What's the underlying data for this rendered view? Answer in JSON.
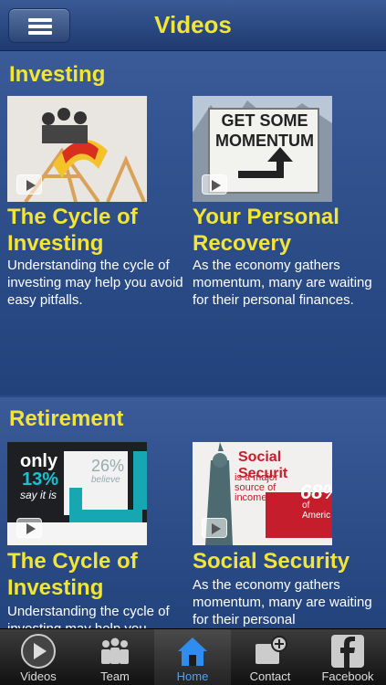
{
  "header": {
    "title": "Videos"
  },
  "sections": [
    {
      "title": "Investing",
      "videos": [
        {
          "title": "The Cycle of Investing",
          "description": "Understanding the cycle of investing may help you avoid easy pitfalls."
        },
        {
          "title": "Your Personal Recovery",
          "description": "As the economy gathers momentum, many are waiting for their personal finances.",
          "thumb_text": "GET SOME MOMENTUM"
        }
      ]
    },
    {
      "title": "Retirement",
      "videos": [
        {
          "title": "The Cycle of Investing",
          "description": "Understanding the cycle of investing may help you...",
          "thumb_text": {
            "only": "only",
            "pct": "13%",
            "say": "say it is",
            "pct2": "26%",
            "believe": "believe"
          }
        },
        {
          "title": "Social Security",
          "description": "As the economy gathers momentum, many are waiting for their personal",
          "thumb_text": {
            "headline": "Social Securit",
            "body": "is a major source of income fo",
            "pct": "68%",
            "sub": "of Americ"
          }
        }
      ]
    }
  ],
  "tabbar": {
    "tabs": [
      {
        "label": "Videos",
        "icon": "play-icon"
      },
      {
        "label": "Team",
        "icon": "team-icon"
      },
      {
        "label": "Home",
        "icon": "home-icon",
        "active": true
      },
      {
        "label": "Contact",
        "icon": "contact-icon"
      },
      {
        "label": "Facebook",
        "icon": "facebook-icon"
      }
    ]
  },
  "colors": {
    "accent": "#f2e535",
    "active_tab": "#4fa3f7"
  }
}
